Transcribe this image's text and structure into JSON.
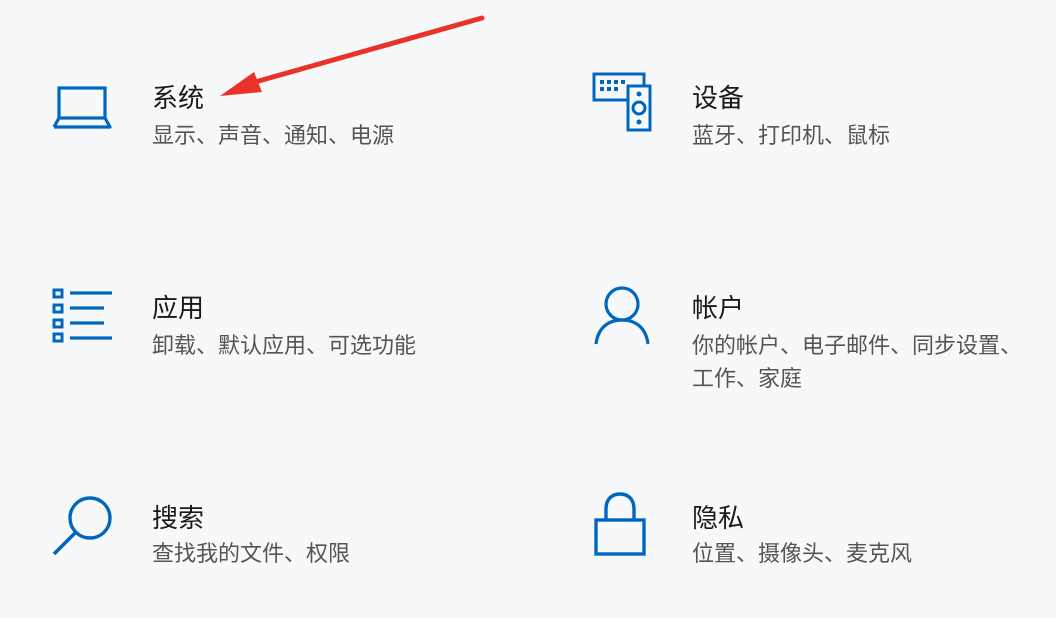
{
  "accent_color": "#0067c0",
  "annotation_arrow_color": "#e8322a",
  "tiles": [
    {
      "id": "system",
      "icon": "laptop-icon",
      "title": "系统",
      "description": "显示、声音、通知、电源"
    },
    {
      "id": "devices",
      "icon": "devices-icon",
      "title": "设备",
      "description": "蓝牙、打印机、鼠标"
    },
    {
      "id": "apps",
      "icon": "apps-list-icon",
      "title": "应用",
      "description": "卸载、默认应用、可选功能"
    },
    {
      "id": "accounts",
      "icon": "person-icon",
      "title": "帐户",
      "description": "你的帐户、电子邮件、同步设置、工作、家庭"
    },
    {
      "id": "search",
      "icon": "search-icon",
      "title": "搜索",
      "description": "查找我的文件、权限"
    },
    {
      "id": "privacy",
      "icon": "lock-icon",
      "title": "隐私",
      "description": "位置、摄像头、麦克风"
    }
  ]
}
